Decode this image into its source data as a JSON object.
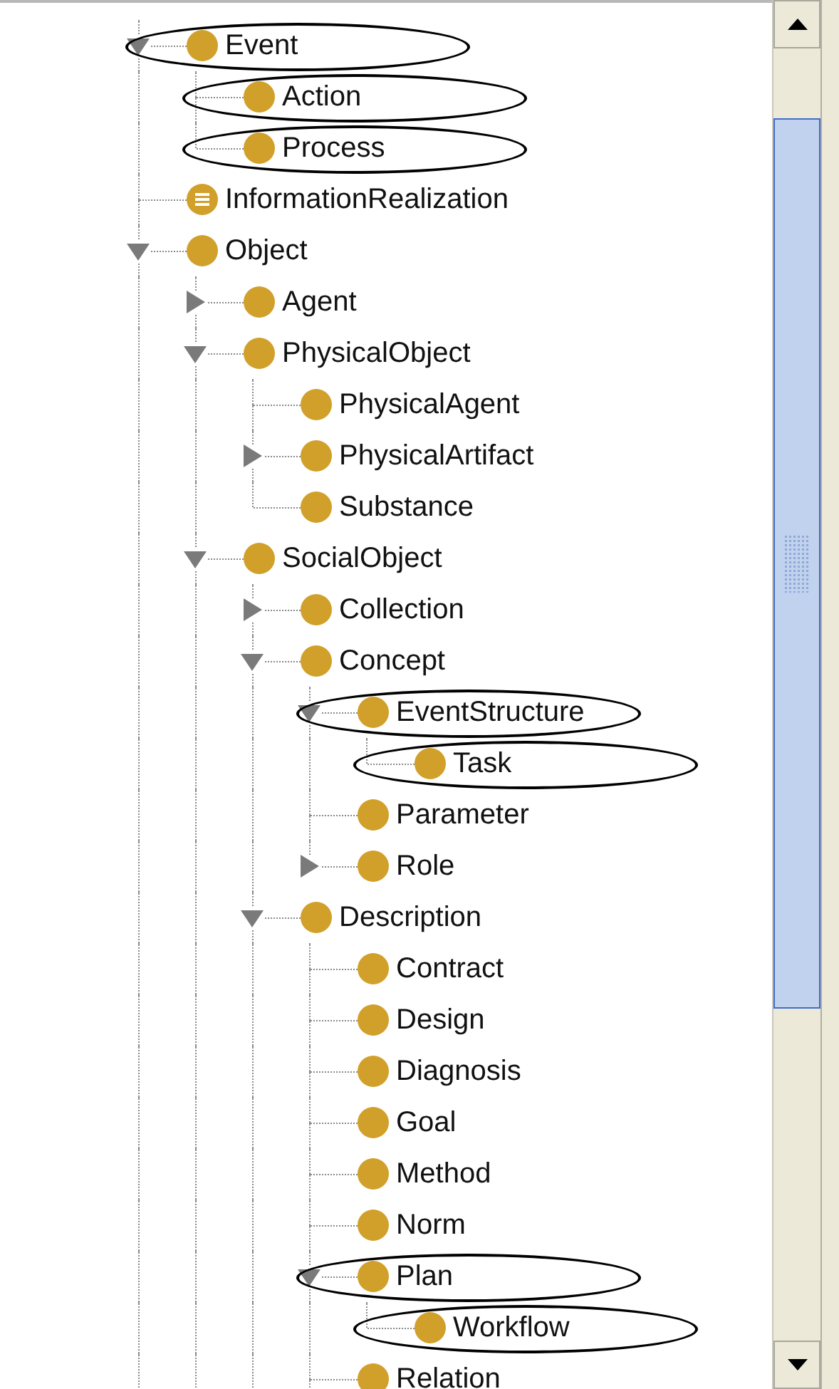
{
  "tree": {
    "nodes": [
      {
        "label": "Event",
        "kind": "class",
        "expanded": true,
        "circled": true,
        "children": [
          {
            "label": "Action",
            "kind": "class",
            "circled": true
          },
          {
            "label": "Process",
            "kind": "class",
            "circled": true
          }
        ]
      },
      {
        "label": "InformationRealization",
        "kind": "defined",
        "circled": false
      },
      {
        "label": "Object",
        "kind": "class",
        "expanded": true,
        "circled": false,
        "children": [
          {
            "label": "Agent",
            "kind": "class",
            "expanded": false,
            "circled": false
          },
          {
            "label": "PhysicalObject",
            "kind": "class",
            "expanded": true,
            "circled": false,
            "children": [
              {
                "label": "PhysicalAgent",
                "kind": "class",
                "circled": false
              },
              {
                "label": "PhysicalArtifact",
                "kind": "class",
                "expanded": false,
                "circled": false
              },
              {
                "label": "Substance",
                "kind": "class",
                "circled": false
              }
            ]
          },
          {
            "label": "SocialObject",
            "kind": "class",
            "expanded": true,
            "circled": false,
            "children": [
              {
                "label": "Collection",
                "kind": "class",
                "expanded": false,
                "circled": false
              },
              {
                "label": "Concept",
                "kind": "class",
                "expanded": true,
                "circled": false,
                "children": [
                  {
                    "label": "EventStructure",
                    "kind": "class",
                    "expanded": true,
                    "circled": true,
                    "children": [
                      {
                        "label": "Task",
                        "kind": "class",
                        "circled": true
                      }
                    ]
                  },
                  {
                    "label": "Parameter",
                    "kind": "class",
                    "circled": false
                  },
                  {
                    "label": "Role",
                    "kind": "class",
                    "expanded": false,
                    "circled": false
                  }
                ]
              },
              {
                "label": "Description",
                "kind": "class",
                "expanded": true,
                "circled": false,
                "children": [
                  {
                    "label": "Contract",
                    "kind": "class",
                    "circled": false
                  },
                  {
                    "label": "Design",
                    "kind": "class",
                    "circled": false
                  },
                  {
                    "label": "Diagnosis",
                    "kind": "class",
                    "circled": false
                  },
                  {
                    "label": "Goal",
                    "kind": "class",
                    "circled": false
                  },
                  {
                    "label": "Method",
                    "kind": "class",
                    "circled": false
                  },
                  {
                    "label": "Norm",
                    "kind": "class",
                    "circled": false
                  },
                  {
                    "label": "Plan",
                    "kind": "class",
                    "expanded": true,
                    "circled": true,
                    "children": [
                      {
                        "label": "Workflow",
                        "kind": "class",
                        "circled": true
                      }
                    ]
                  },
                  {
                    "label": "Relation",
                    "kind": "class",
                    "circled": false
                  }
                ]
              }
            ]
          }
        ]
      }
    ]
  }
}
